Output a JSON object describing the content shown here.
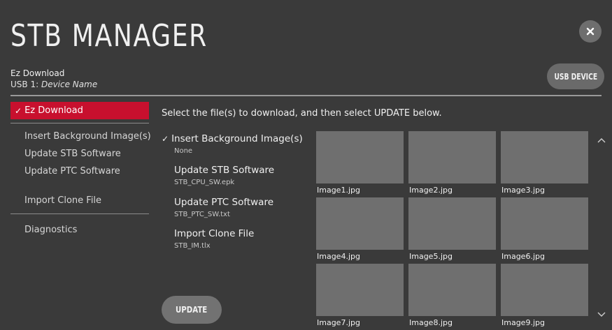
{
  "header": {
    "title": "STB MANAGER",
    "subtitle": "Ez Download",
    "usb_prefix": "USB 1: ",
    "usb_device_name": "Device Name",
    "usb_button": "USB DEVICE",
    "close_icon": "close-icon"
  },
  "sidebar": {
    "active_label": "Ez Download",
    "items": [
      {
        "label": "Insert Background Image(s)"
      },
      {
        "label": "Update STB Software"
      },
      {
        "label": "Update PTC Software"
      },
      {
        "label": "Import Clone File"
      },
      {
        "label": "Diagnostics"
      }
    ]
  },
  "main": {
    "instruction": "Select the file(s) to download, and then select UPDATE below.",
    "files": [
      {
        "title": "Insert Background Image(s)",
        "value": "None",
        "checked": true
      },
      {
        "title": "Update STB Software",
        "value": "STB_CPU_SW.epk",
        "checked": false
      },
      {
        "title": "Update PTC Software",
        "value": "STB_PTC_SW.txt",
        "checked": false
      },
      {
        "title": "Import Clone File",
        "value": "STB_IM.tlx",
        "checked": false
      }
    ],
    "update_button": "UPDATE",
    "images": [
      {
        "label": "Image1.jpg"
      },
      {
        "label": "Image2.jpg"
      },
      {
        "label": "Image3.jpg"
      },
      {
        "label": "Image4.jpg"
      },
      {
        "label": "Image5.jpg"
      },
      {
        "label": "Image6.jpg"
      },
      {
        "label": "Image7.jpg"
      },
      {
        "label": "Image8.jpg"
      },
      {
        "label": "Image9.jpg"
      }
    ]
  },
  "colors": {
    "background": "#3a3a3a",
    "accent": "#c8102e",
    "button": "#6e6e6e",
    "thumbnail": "#6f6f6f"
  }
}
